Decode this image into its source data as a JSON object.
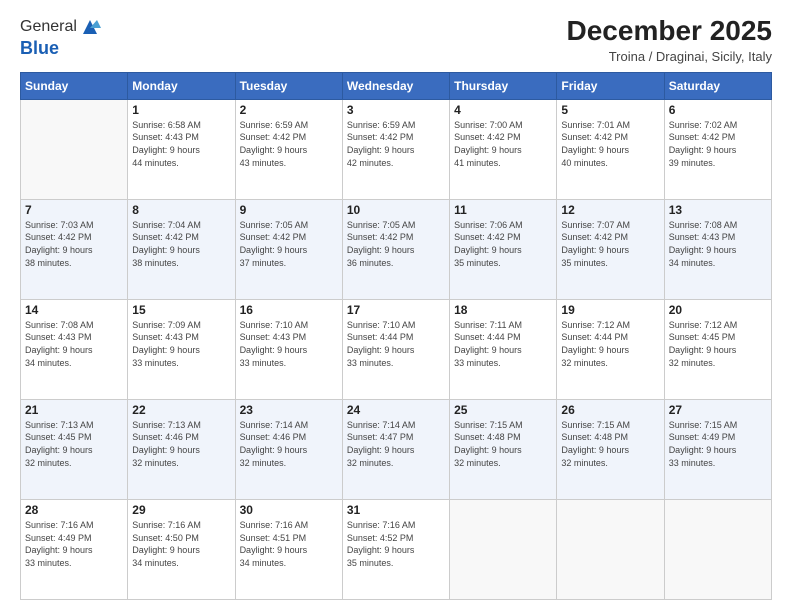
{
  "logo": {
    "general": "General",
    "blue": "Blue"
  },
  "header": {
    "month_year": "December 2025",
    "location": "Troina / Draginai, Sicily, Italy"
  },
  "weekdays": [
    "Sunday",
    "Monday",
    "Tuesday",
    "Wednesday",
    "Thursday",
    "Friday",
    "Saturday"
  ],
  "weeks": [
    [
      {
        "day": "",
        "sunrise": "",
        "sunset": "",
        "daylight": ""
      },
      {
        "day": "1",
        "sunrise": "Sunrise: 6:58 AM",
        "sunset": "Sunset: 4:43 PM",
        "daylight": "Daylight: 9 hours and 44 minutes."
      },
      {
        "day": "2",
        "sunrise": "Sunrise: 6:59 AM",
        "sunset": "Sunset: 4:42 PM",
        "daylight": "Daylight: 9 hours and 43 minutes."
      },
      {
        "day": "3",
        "sunrise": "Sunrise: 6:59 AM",
        "sunset": "Sunset: 4:42 PM",
        "daylight": "Daylight: 9 hours and 42 minutes."
      },
      {
        "day": "4",
        "sunrise": "Sunrise: 7:00 AM",
        "sunset": "Sunset: 4:42 PM",
        "daylight": "Daylight: 9 hours and 41 minutes."
      },
      {
        "day": "5",
        "sunrise": "Sunrise: 7:01 AM",
        "sunset": "Sunset: 4:42 PM",
        "daylight": "Daylight: 9 hours and 40 minutes."
      },
      {
        "day": "6",
        "sunrise": "Sunrise: 7:02 AM",
        "sunset": "Sunset: 4:42 PM",
        "daylight": "Daylight: 9 hours and 39 minutes."
      }
    ],
    [
      {
        "day": "7",
        "sunrise": "Sunrise: 7:03 AM",
        "sunset": "Sunset: 4:42 PM",
        "daylight": "Daylight: 9 hours and 38 minutes."
      },
      {
        "day": "8",
        "sunrise": "Sunrise: 7:04 AM",
        "sunset": "Sunset: 4:42 PM",
        "daylight": "Daylight: 9 hours and 38 minutes."
      },
      {
        "day": "9",
        "sunrise": "Sunrise: 7:05 AM",
        "sunset": "Sunset: 4:42 PM",
        "daylight": "Daylight: 9 hours and 37 minutes."
      },
      {
        "day": "10",
        "sunrise": "Sunrise: 7:05 AM",
        "sunset": "Sunset: 4:42 PM",
        "daylight": "Daylight: 9 hours and 36 minutes."
      },
      {
        "day": "11",
        "sunrise": "Sunrise: 7:06 AM",
        "sunset": "Sunset: 4:42 PM",
        "daylight": "Daylight: 9 hours and 35 minutes."
      },
      {
        "day": "12",
        "sunrise": "Sunrise: 7:07 AM",
        "sunset": "Sunset: 4:42 PM",
        "daylight": "Daylight: 9 hours and 35 minutes."
      },
      {
        "day": "13",
        "sunrise": "Sunrise: 7:08 AM",
        "sunset": "Sunset: 4:43 PM",
        "daylight": "Daylight: 9 hours and 34 minutes."
      }
    ],
    [
      {
        "day": "14",
        "sunrise": "Sunrise: 7:08 AM",
        "sunset": "Sunset: 4:43 PM",
        "daylight": "Daylight: 9 hours and 34 minutes."
      },
      {
        "day": "15",
        "sunrise": "Sunrise: 7:09 AM",
        "sunset": "Sunset: 4:43 PM",
        "daylight": "Daylight: 9 hours and 33 minutes."
      },
      {
        "day": "16",
        "sunrise": "Sunrise: 7:10 AM",
        "sunset": "Sunset: 4:43 PM",
        "daylight": "Daylight: 9 hours and 33 minutes."
      },
      {
        "day": "17",
        "sunrise": "Sunrise: 7:10 AM",
        "sunset": "Sunset: 4:44 PM",
        "daylight": "Daylight: 9 hours and 33 minutes."
      },
      {
        "day": "18",
        "sunrise": "Sunrise: 7:11 AM",
        "sunset": "Sunset: 4:44 PM",
        "daylight": "Daylight: 9 hours and 33 minutes."
      },
      {
        "day": "19",
        "sunrise": "Sunrise: 7:12 AM",
        "sunset": "Sunset: 4:44 PM",
        "daylight": "Daylight: 9 hours and 32 minutes."
      },
      {
        "day": "20",
        "sunrise": "Sunrise: 7:12 AM",
        "sunset": "Sunset: 4:45 PM",
        "daylight": "Daylight: 9 hours and 32 minutes."
      }
    ],
    [
      {
        "day": "21",
        "sunrise": "Sunrise: 7:13 AM",
        "sunset": "Sunset: 4:45 PM",
        "daylight": "Daylight: 9 hours and 32 minutes."
      },
      {
        "day": "22",
        "sunrise": "Sunrise: 7:13 AM",
        "sunset": "Sunset: 4:46 PM",
        "daylight": "Daylight: 9 hours and 32 minutes."
      },
      {
        "day": "23",
        "sunrise": "Sunrise: 7:14 AM",
        "sunset": "Sunset: 4:46 PM",
        "daylight": "Daylight: 9 hours and 32 minutes."
      },
      {
        "day": "24",
        "sunrise": "Sunrise: 7:14 AM",
        "sunset": "Sunset: 4:47 PM",
        "daylight": "Daylight: 9 hours and 32 minutes."
      },
      {
        "day": "25",
        "sunrise": "Sunrise: 7:15 AM",
        "sunset": "Sunset: 4:48 PM",
        "daylight": "Daylight: 9 hours and 32 minutes."
      },
      {
        "day": "26",
        "sunrise": "Sunrise: 7:15 AM",
        "sunset": "Sunset: 4:48 PM",
        "daylight": "Daylight: 9 hours and 32 minutes."
      },
      {
        "day": "27",
        "sunrise": "Sunrise: 7:15 AM",
        "sunset": "Sunset: 4:49 PM",
        "daylight": "Daylight: 9 hours and 33 minutes."
      }
    ],
    [
      {
        "day": "28",
        "sunrise": "Sunrise: 7:16 AM",
        "sunset": "Sunset: 4:49 PM",
        "daylight": "Daylight: 9 hours and 33 minutes."
      },
      {
        "day": "29",
        "sunrise": "Sunrise: 7:16 AM",
        "sunset": "Sunset: 4:50 PM",
        "daylight": "Daylight: 9 hours and 34 minutes."
      },
      {
        "day": "30",
        "sunrise": "Sunrise: 7:16 AM",
        "sunset": "Sunset: 4:51 PM",
        "daylight": "Daylight: 9 hours and 34 minutes."
      },
      {
        "day": "31",
        "sunrise": "Sunrise: 7:16 AM",
        "sunset": "Sunset: 4:52 PM",
        "daylight": "Daylight: 9 hours and 35 minutes."
      },
      {
        "day": "",
        "sunrise": "",
        "sunset": "",
        "daylight": ""
      },
      {
        "day": "",
        "sunrise": "",
        "sunset": "",
        "daylight": ""
      },
      {
        "day": "",
        "sunrise": "",
        "sunset": "",
        "daylight": ""
      }
    ]
  ]
}
